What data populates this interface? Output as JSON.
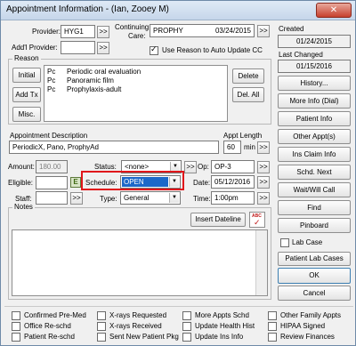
{
  "window": {
    "title": "Appointment Information - (Ian, Zooey M)",
    "close_glyph": "✕"
  },
  "provider": {
    "label": "Provider:",
    "value": "HYG1",
    "more": ">>"
  },
  "addl_provider": {
    "label": "Add'l Provider:",
    "value": "",
    "more": ">>"
  },
  "continuing_care": {
    "label_line1": "Continuing",
    "label_line2": "Care:",
    "value": "PROPHY",
    "date": "03/24/2015",
    "more": ">>"
  },
  "use_reason": {
    "label": "Use Reason to Auto Update CC",
    "checked": true
  },
  "reason": {
    "group_label": "Reason",
    "initial_button": "Initial",
    "add_tx_button": "Add Tx",
    "misc_button": "Misc.",
    "delete_button": "Delete",
    "del_all_button": "Del. All",
    "items": [
      {
        "code": "Pc",
        "description": "Periodic oral evaluation"
      },
      {
        "code": "Pc",
        "description": "Panoramic film"
      },
      {
        "code": "Pc",
        "description": "Prophylaxis-adult"
      }
    ]
  },
  "appt_description": {
    "label": "Appointment Description",
    "value": "PeriodicX, Pano, ProphyAd"
  },
  "appt_length": {
    "label": "Appt Length",
    "value": "60",
    "unit": "min",
    "more": ">>"
  },
  "amount": {
    "label": "Amount:",
    "value": "180.00"
  },
  "status": {
    "label": "Status:",
    "value": "<none>",
    "more": ">>"
  },
  "op": {
    "label": "Op:",
    "value": "OP-3",
    "more": ">>"
  },
  "eligible": {
    "label": "Eligible:",
    "badge": "E"
  },
  "schedule": {
    "label": "Schedule:",
    "value": "OPEN"
  },
  "date": {
    "label": "Date:",
    "value": "05/12/2016",
    "more": ">>"
  },
  "staff": {
    "label": "Staff:",
    "value": "",
    "more": ">>"
  },
  "type": {
    "label": "Type:",
    "value": "General"
  },
  "time": {
    "label": "Time:",
    "value": "1:00pm",
    "more": ">>"
  },
  "notes": {
    "group_label": "Notes",
    "insert_dateline": "Insert Dateline",
    "abc_badge": "ABC"
  },
  "created": {
    "label": "Created",
    "value": "01/24/2015"
  },
  "last_changed": {
    "label": "Last Changed",
    "value": "01/15/2016"
  },
  "side_buttons": {
    "history": "History...",
    "more_info": "More Info (Dial)",
    "patient_info": "Patient Info",
    "other_appts": "Other Appt(s)",
    "ins_claim_info": "Ins Claim Info",
    "schd_next": "Schd. Next",
    "wait_will_call": "Wait/Will Call",
    "find": "Find",
    "pinboard": "Pinboard",
    "lab_case": "Lab Case",
    "patient_lab_cases": "Patient Lab Cases",
    "ok": "OK",
    "cancel": "Cancel"
  },
  "bottom_checks": [
    {
      "label": "Confirmed Pre-Med",
      "checked": false
    },
    {
      "label": "X-rays Requested",
      "checked": false
    },
    {
      "label": "More Appts Schd",
      "checked": false
    },
    {
      "label": "Other Family Appts",
      "checked": false
    },
    {
      "label": "Office Re-schd",
      "checked": false
    },
    {
      "label": "X-rays Received",
      "checked": false
    },
    {
      "label": "Update Health Hist",
      "checked": false
    },
    {
      "label": "HIPAA Signed",
      "checked": false
    },
    {
      "label": "Patient Re-schd",
      "checked": false
    },
    {
      "label": "Sent New Patient Pkg",
      "checked": false
    },
    {
      "label": "Update Ins Info",
      "checked": false
    },
    {
      "label": "Review Finances",
      "checked": false
    }
  ],
  "colors": {
    "schedule_highlight": "#1c68c8",
    "annotation_box": "#e0161b"
  }
}
